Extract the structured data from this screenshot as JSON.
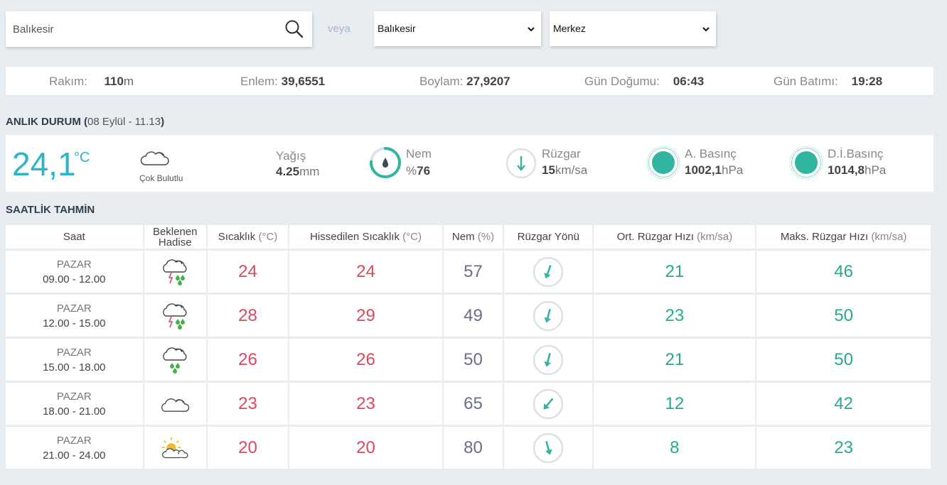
{
  "search": {
    "value": "Balıkesir"
  },
  "veya": "veya",
  "province_select": {
    "selected": "Balıkesir"
  },
  "district_select": {
    "selected": "Merkez"
  },
  "info": {
    "rakim_label": "Rakım:",
    "rakim_value": "110",
    "rakim_unit": "m",
    "enlem_label": "Enlem:",
    "enlem_value": "39,6551",
    "boylam_label": "Boylam:",
    "boylam_value": "27,9207",
    "gundogumu_label": "Gün Doğumu:",
    "gundogumu_value": "06:43",
    "gunbatimi_label": "Gün Batımı:",
    "gunbatimi_value": "19:28"
  },
  "current": {
    "title": "ANLIK DURUM (",
    "datetime": "08 Eylül - 11.13",
    "title_close": ")",
    "temperature": "24,1",
    "temp_unit": "°C",
    "condition": "Çok Bulutlu",
    "condition_icon": "cloud-icon",
    "yagis_label": "Yağış",
    "yagis_value": "4.25",
    "yagis_unit": "mm",
    "nem_label": "Nem",
    "nem_prefix": "%",
    "nem_value": "76",
    "ruzgar_label": "Rüzgar",
    "ruzgar_value": "15",
    "ruzgar_unit": "km/sa",
    "abasinc_label": "A. Basınç",
    "abasinc_value": "1002,1",
    "abasinc_unit": "hPa",
    "dibasinc_label": "D.İ.Basınç",
    "dibasinc_value": "1014,8",
    "dibasinc_unit": "hPa",
    "colors": {
      "accent": "#2cb4c7",
      "teal": "#2fb5a0"
    }
  },
  "hourly": {
    "title": "SAATLİK TAHMİN",
    "headers": {
      "saat": "Saat",
      "hadise": "Beklenen Hadise",
      "sicaklik": "Sıcaklık",
      "sicaklik_unit": "(°C)",
      "hissedilen": "Hissedilen Sıcaklık",
      "hissedilen_unit": "(°C)",
      "nem": "Nem",
      "nem_unit": "(%)",
      "yon": "Rüzgar Yönü",
      "ort": "Ort. Rüzgar Hızı",
      "ort_unit": "(km/sa)",
      "maks": "Maks. Rüzgar Hızı",
      "maks_unit": "(km/sa)"
    },
    "rows": [
      {
        "day": "PAZAR",
        "time": "09.00 - 12.00",
        "icon": "thunder-rain-icon",
        "temp": "24",
        "feels": "24",
        "humidity": "57",
        "wind_dir_deg": 200,
        "avg": "21",
        "max": "46"
      },
      {
        "day": "PAZAR",
        "time": "12.00 - 15.00",
        "icon": "thunder-rain-icon",
        "temp": "28",
        "feels": "29",
        "humidity": "49",
        "wind_dir_deg": 195,
        "avg": "23",
        "max": "50"
      },
      {
        "day": "PAZAR",
        "time": "15.00 - 18.00",
        "icon": "rain-cloud-icon",
        "temp": "26",
        "feels": "26",
        "humidity": "50",
        "wind_dir_deg": 195,
        "avg": "21",
        "max": "50"
      },
      {
        "day": "PAZAR",
        "time": "18.00 - 21.00",
        "icon": "cloud-icon",
        "temp": "23",
        "feels": "23",
        "humidity": "65",
        "wind_dir_deg": 220,
        "avg": "12",
        "max": "42"
      },
      {
        "day": "PAZAR",
        "time": "21.00 - 24.00",
        "icon": "sun-cloud-icon",
        "temp": "20",
        "feels": "20",
        "humidity": "80",
        "wind_dir_deg": 165,
        "avg": "8",
        "max": "23"
      }
    ]
  }
}
